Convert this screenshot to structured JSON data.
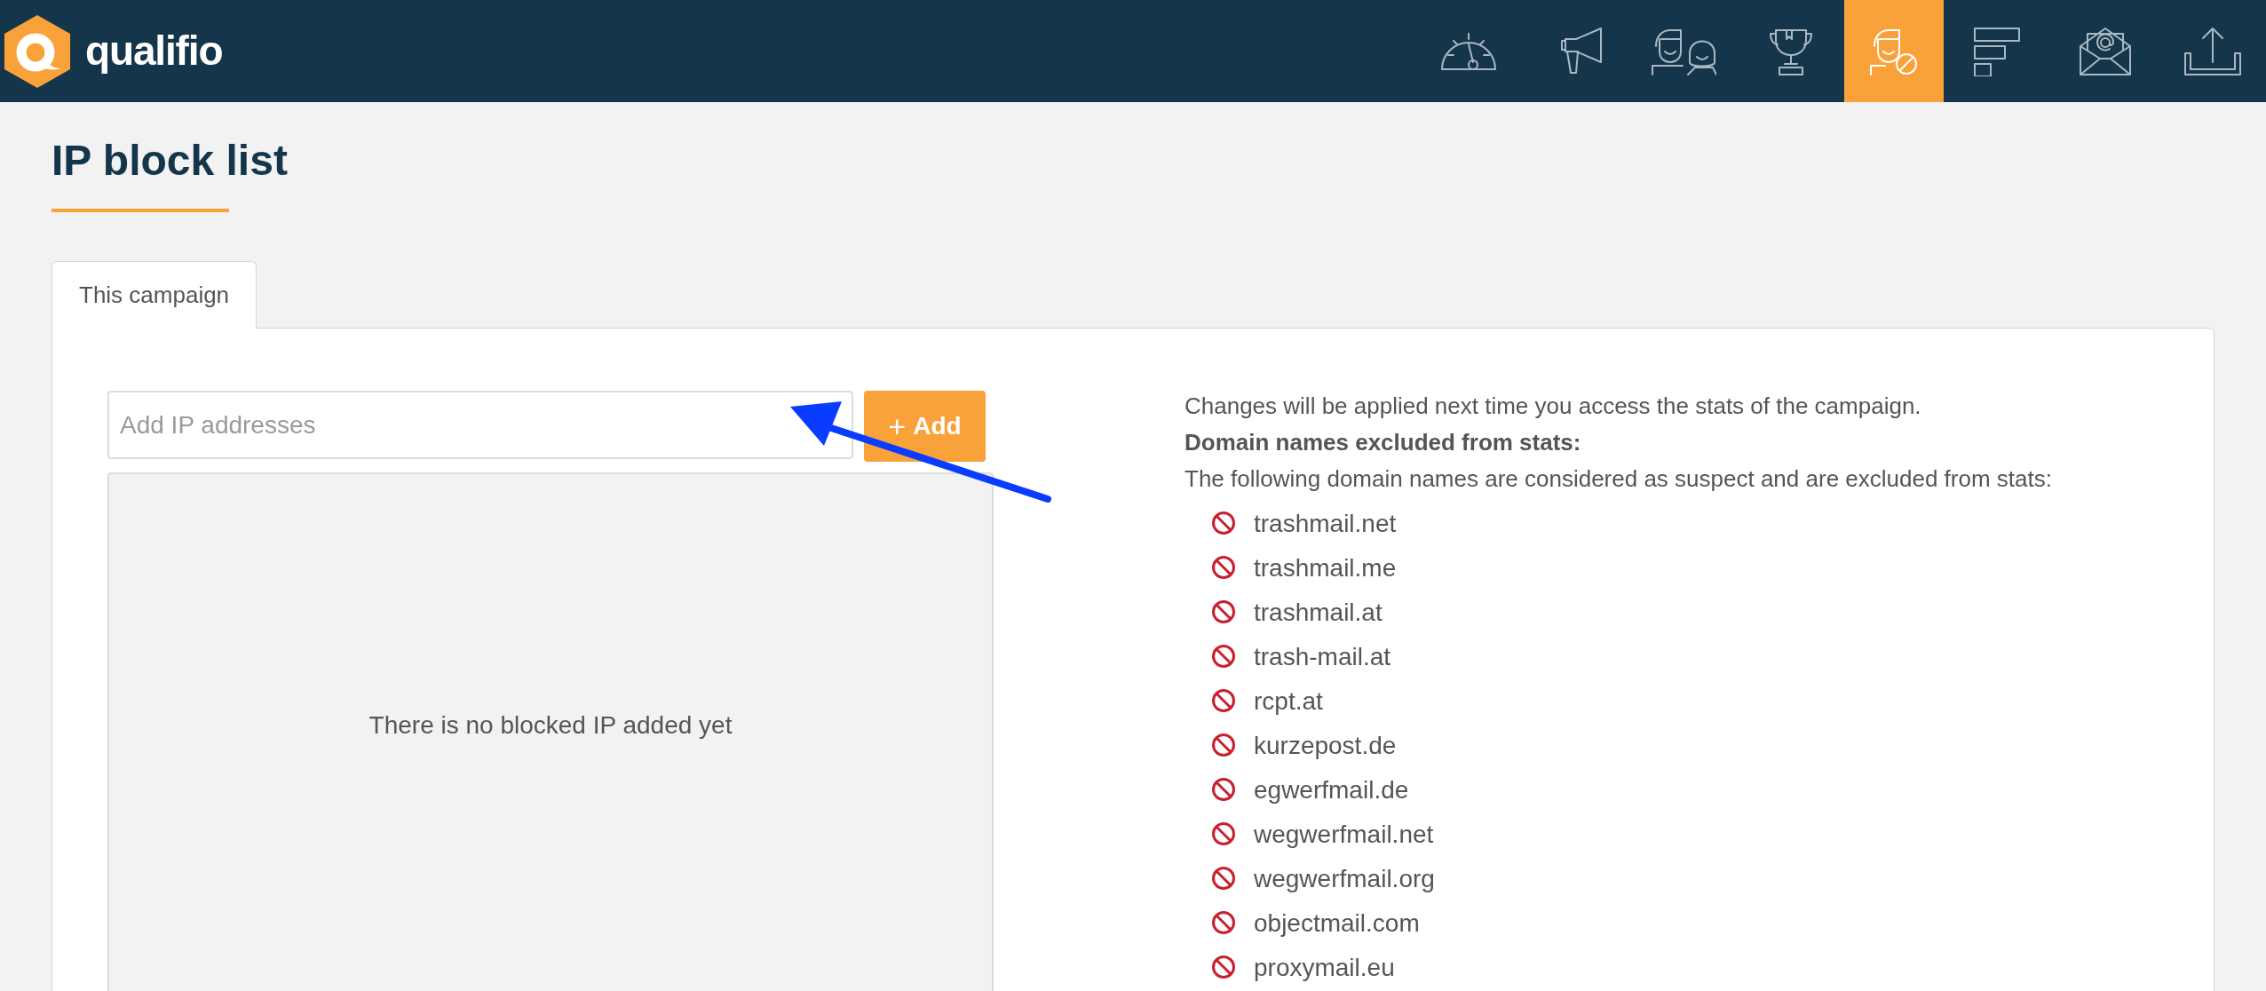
{
  "header": {
    "logo": "qualifio",
    "nav": [
      {
        "kind": "gauge",
        "selected": false
      },
      {
        "kind": "megaphone",
        "selected": false
      },
      {
        "kind": "people",
        "selected": false
      },
      {
        "kind": "trophy",
        "selected": false
      },
      {
        "kind": "blocked-user",
        "selected": true
      },
      {
        "kind": "bars",
        "selected": false
      },
      {
        "kind": "mail",
        "selected": false
      },
      {
        "kind": "upload",
        "selected": false
      }
    ]
  },
  "page_title": "IP block list",
  "tabs": [
    {
      "label": "This campaign",
      "selected": true
    }
  ],
  "ip_input": {
    "placeholder": "Add IP addresses"
  },
  "add_button": {
    "icon": "+",
    "label": "Add"
  },
  "empty_message": "There is no blocked IP added yet",
  "info": {
    "notice": "Changes will be applied next time you access the stats of the campaign.",
    "heading": "Domain names excluded from stats:",
    "description": "The following domain names are considered as suspect and are excluded from stats:",
    "domains": [
      "trashmail.net",
      "trashmail.me",
      "trashmail.at",
      "trash-mail.at",
      "rcpt.at",
      "kurzepost.de",
      "egwerfmail.de",
      "wegwerfmail.net",
      "wegwerfmail.org",
      "objectmail.com",
      "proxymail.eu"
    ]
  }
}
